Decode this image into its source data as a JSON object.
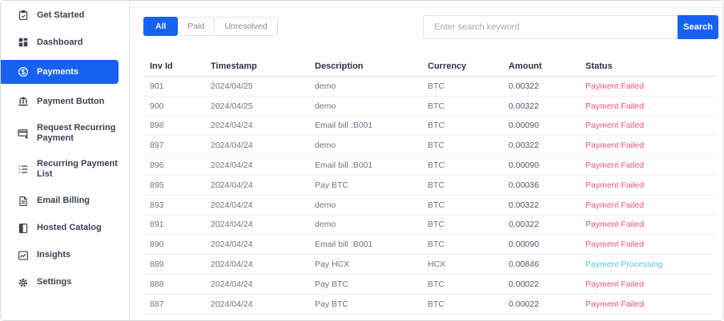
{
  "sidebar": {
    "items": [
      {
        "label": "Get Started",
        "icon": "clipboard-icon",
        "active": false
      },
      {
        "label": "Dashboard",
        "icon": "dashboard-icon",
        "active": false
      },
      {
        "label": "Payments",
        "icon": "coin-dollar-icon",
        "active": true
      },
      {
        "label": "Payment Button",
        "icon": "bank-icon",
        "active": false
      },
      {
        "label": "Request Recurring Payment",
        "icon": "card-plus-icon",
        "active": false
      },
      {
        "label": "Recurring Payment List",
        "icon": "list-icon",
        "active": false
      },
      {
        "label": "Email Billing",
        "icon": "document-icon",
        "active": false
      },
      {
        "label": "Hosted Catalog",
        "icon": "book-icon",
        "active": false
      },
      {
        "label": "Insights",
        "icon": "chart-icon",
        "active": false
      },
      {
        "label": "Settings",
        "icon": "gear-icon",
        "active": false
      }
    ]
  },
  "filters": {
    "tabs": [
      {
        "label": "All",
        "active": true
      },
      {
        "label": "Paid",
        "active": false
      },
      {
        "label": "Unresolved",
        "active": false
      }
    ]
  },
  "search": {
    "placeholder": "Enter search keyword",
    "button_label": "Search"
  },
  "table": {
    "columns": [
      "Inv Id",
      "Timestamp",
      "Description",
      "Currency",
      "Amount",
      "Status"
    ],
    "rows": [
      {
        "inv_id": "901",
        "timestamp": "2024/04/25",
        "description": "demo",
        "currency": "BTC",
        "amount": "0.00322",
        "status": "Payment Failed"
      },
      {
        "inv_id": "900",
        "timestamp": "2024/04/25",
        "description": "demo",
        "currency": "BTC",
        "amount": "0.00322",
        "status": "Payment Failed"
      },
      {
        "inv_id": "898",
        "timestamp": "2024/04/24",
        "description": "Email bill :B001",
        "currency": "BTC",
        "amount": "0.00090",
        "status": "Payment Failed"
      },
      {
        "inv_id": "897",
        "timestamp": "2024/04/24",
        "description": "demo",
        "currency": "BTC",
        "amount": "0.00322",
        "status": "Payment Failed"
      },
      {
        "inv_id": "896",
        "timestamp": "2024/04/24",
        "description": "Email bill :B001",
        "currency": "BTC",
        "amount": "0.00090",
        "status": "Payment Failed"
      },
      {
        "inv_id": "895",
        "timestamp": "2024/04/24",
        "description": "Pay BTC",
        "currency": "BTC",
        "amount": "0.00036",
        "status": "Payment Failed"
      },
      {
        "inv_id": "893",
        "timestamp": "2024/04/24",
        "description": "demo",
        "currency": "BTC",
        "amount": "0.00322",
        "status": "Payment Failed"
      },
      {
        "inv_id": "891",
        "timestamp": "2024/04/24",
        "description": "demo",
        "currency": "BTC",
        "amount": "0.00322",
        "status": "Payment Failed"
      },
      {
        "inv_id": "890",
        "timestamp": "2024/04/24",
        "description": "Email bill :B001",
        "currency": "BTC",
        "amount": "0.00090",
        "status": "Payment Failed"
      },
      {
        "inv_id": "889",
        "timestamp": "2024/04/24",
        "description": "Pay HCX",
        "currency": "HCX",
        "amount": "0.00846",
        "status": "Payment Processing"
      },
      {
        "inv_id": "888",
        "timestamp": "2024/04/24",
        "description": "Pay BTC",
        "currency": "BTC",
        "amount": "0.00022",
        "status": "Payment Failed"
      },
      {
        "inv_id": "887",
        "timestamp": "2024/04/24",
        "description": "Pay BTC",
        "currency": "BTC",
        "amount": "0.00022",
        "status": "Payment Failed"
      }
    ]
  },
  "colors": {
    "primary": "#1661F2",
    "status": {
      "Payment Failed": "#F45470",
      "Payment Processing": "#55C3EF"
    }
  }
}
